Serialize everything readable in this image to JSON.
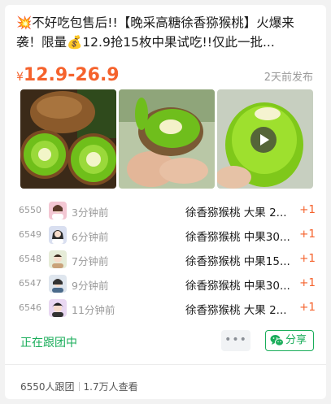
{
  "product": {
    "title": "💥不好吃包售后!!【晚采高糖徐香猕猴桃】火爆来袭！限量💰12.9抢15枚中果试吃!!仅此一批...",
    "price_currency": "¥",
    "price_range": "12.9-26.9",
    "posted": "2天前发布",
    "images": [
      "kiwi-halves-photo",
      "kiwi-hand-photo",
      "kiwi-video-thumbnail"
    ]
  },
  "orders": [
    {
      "id": "6550",
      "time": "3分钟前",
      "item": "徐香猕猴桃 大果 2...",
      "qty": "+1"
    },
    {
      "id": "6549",
      "time": "6分钟前",
      "item": "徐香猕猴桃 中果30...",
      "qty": "+1"
    },
    {
      "id": "6548",
      "time": "7分钟前",
      "item": "徐香猕猴桃 中果15...",
      "qty": "+1"
    },
    {
      "id": "6547",
      "time": "9分钟前",
      "item": "徐香猕猴桃 中果30...",
      "qty": "+1"
    },
    {
      "id": "6546",
      "time": "11分钟前",
      "item": "徐香猕猴桃 大果 2...",
      "qty": "+1"
    }
  ],
  "actions": {
    "status": "正在跟团中",
    "more": "•••",
    "share": "分享"
  },
  "stats": {
    "followers": "6550人跟团",
    "views": "1.7万人查看"
  },
  "colors": {
    "price": "#f5622c",
    "accent_green": "#1aad5a",
    "muted": "#9a9a9a"
  }
}
